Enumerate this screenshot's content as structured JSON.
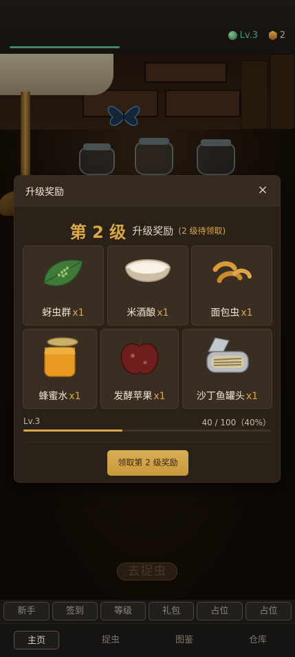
{
  "header": {
    "level_text": "Lv.3",
    "coin_count": "2",
    "xp_progress": 1.0
  },
  "scene": {
    "cta_label": "去捉虫"
  },
  "modal": {
    "title": "升级奖励",
    "close_glyph": "×",
    "headline_big": "第 2 级",
    "headline_mid": "升级奖励",
    "headline_small": "(2 级待领取)",
    "rewards": [
      {
        "name": "蚜虫群",
        "qty": "x1",
        "icon": "leaf-aphids-icon"
      },
      {
        "name": "米酒酿",
        "qty": "x1",
        "icon": "rice-wine-bowl-icon"
      },
      {
        "name": "面包虫",
        "qty": "x1",
        "icon": "mealworm-icon"
      },
      {
        "name": "蜂蜜水",
        "qty": "x1",
        "icon": "honey-jar-icon"
      },
      {
        "name": "发酵苹果",
        "qty": "x1",
        "icon": "fermented-apple-icon"
      },
      {
        "name": "沙丁鱼罐头",
        "qty": "x1",
        "icon": "sardine-can-icon"
      }
    ],
    "level_label": "Lv.3",
    "progress_text": "40 / 100（40%）",
    "progress_fraction": 0.4,
    "claim_label": "领取第 2 级奖励"
  },
  "quickbar": [
    "新手",
    "签到",
    "等级",
    "礼包",
    "占位",
    "占位"
  ],
  "tabs": [
    {
      "label": "主页",
      "active": true
    },
    {
      "label": "捉虫",
      "active": false
    },
    {
      "label": "图鉴",
      "active": false
    },
    {
      "label": "仓库",
      "active": false
    }
  ],
  "colors": {
    "accent": "#d9a84a",
    "level_green": "#3e9d72",
    "modal_bg": "#2a2118"
  }
}
